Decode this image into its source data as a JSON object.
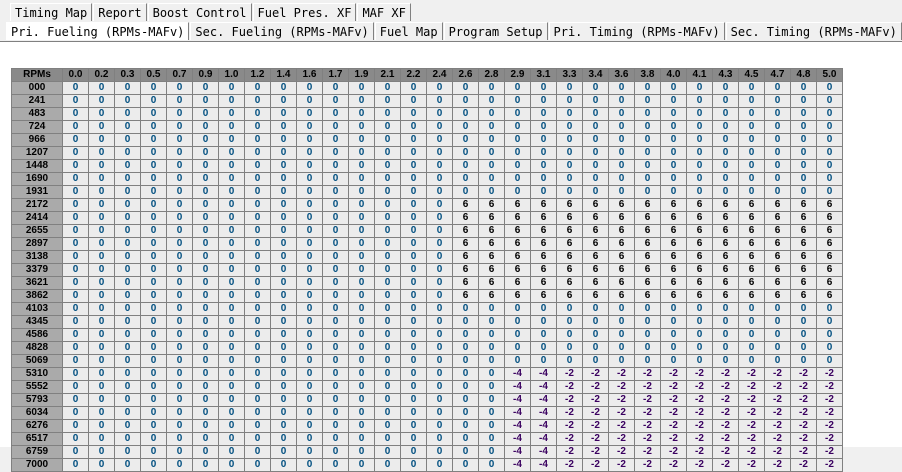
{
  "tabs_row1": [
    "Timing Map",
    "Report",
    "Boost Control",
    "Fuel Pres. XF",
    "MAF XF"
  ],
  "tabs_row2": [
    "Pri. Fueling (RPMs-MAFv)",
    "Sec. Fueling (RPMs-MAFv)",
    "Fuel Map",
    "Program Setup",
    "Pri. Timing (RPMs-MAFv)",
    "Sec. Timing (RPMs-MAFv)"
  ],
  "active_tab": "Pri. Fueling (RPMs-MAFv)",
  "grid": {
    "corner_label": "RPMs",
    "columns": [
      "0.0",
      "0.2",
      "0.3",
      "0.5",
      "0.7",
      "0.9",
      "1.0",
      "1.2",
      "1.4",
      "1.6",
      "1.7",
      "1.9",
      "2.1",
      "2.2",
      "2.4",
      "2.6",
      "2.8",
      "2.9",
      "3.1",
      "3.3",
      "3.4",
      "3.6",
      "3.8",
      "4.0",
      "4.1",
      "4.3",
      "4.5",
      "4.7",
      "4.8",
      "5.0"
    ],
    "rows": [
      {
        "rpm": "000",
        "values": [
          "0",
          "0",
          "0",
          "0",
          "0",
          "0",
          "0",
          "0",
          "0",
          "0",
          "0",
          "0",
          "0",
          "0",
          "0",
          "0",
          "0",
          "0",
          "0",
          "0",
          "0",
          "0",
          "0",
          "0",
          "0",
          "0",
          "0",
          "0",
          "0",
          "0"
        ]
      },
      {
        "rpm": "241",
        "values": [
          "0",
          "0",
          "0",
          "0",
          "0",
          "0",
          "0",
          "0",
          "0",
          "0",
          "0",
          "0",
          "0",
          "0",
          "0",
          "0",
          "0",
          "0",
          "0",
          "0",
          "0",
          "0",
          "0",
          "0",
          "0",
          "0",
          "0",
          "0",
          "0",
          "0"
        ]
      },
      {
        "rpm": "483",
        "values": [
          "0",
          "0",
          "0",
          "0",
          "0",
          "0",
          "0",
          "0",
          "0",
          "0",
          "0",
          "0",
          "0",
          "0",
          "0",
          "0",
          "0",
          "0",
          "0",
          "0",
          "0",
          "0",
          "0",
          "0",
          "0",
          "0",
          "0",
          "0",
          "0",
          "0"
        ]
      },
      {
        "rpm": "724",
        "values": [
          "0",
          "0",
          "0",
          "0",
          "0",
          "0",
          "0",
          "0",
          "0",
          "0",
          "0",
          "0",
          "0",
          "0",
          "0",
          "0",
          "0",
          "0",
          "0",
          "0",
          "0",
          "0",
          "0",
          "0",
          "0",
          "0",
          "0",
          "0",
          "0",
          "0"
        ]
      },
      {
        "rpm": "966",
        "values": [
          "0",
          "0",
          "0",
          "0",
          "0",
          "0",
          "0",
          "0",
          "0",
          "0",
          "0",
          "0",
          "0",
          "0",
          "0",
          "0",
          "0",
          "0",
          "0",
          "0",
          "0",
          "0",
          "0",
          "0",
          "0",
          "0",
          "0",
          "0",
          "0",
          "0"
        ]
      },
      {
        "rpm": "1207",
        "values": [
          "0",
          "0",
          "0",
          "0",
          "0",
          "0",
          "0",
          "0",
          "0",
          "0",
          "0",
          "0",
          "0",
          "0",
          "0",
          "0",
          "0",
          "0",
          "0",
          "0",
          "0",
          "0",
          "0",
          "0",
          "0",
          "0",
          "0",
          "0",
          "0",
          "0"
        ]
      },
      {
        "rpm": "1448",
        "values": [
          "0",
          "0",
          "0",
          "0",
          "0",
          "0",
          "0",
          "0",
          "0",
          "0",
          "0",
          "0",
          "0",
          "0",
          "0",
          "0",
          "0",
          "0",
          "0",
          "0",
          "0",
          "0",
          "0",
          "0",
          "0",
          "0",
          "0",
          "0",
          "0",
          "0"
        ]
      },
      {
        "rpm": "1690",
        "values": [
          "0",
          "0",
          "0",
          "0",
          "0",
          "0",
          "0",
          "0",
          "0",
          "0",
          "0",
          "0",
          "0",
          "0",
          "0",
          "0",
          "0",
          "0",
          "0",
          "0",
          "0",
          "0",
          "0",
          "0",
          "0",
          "0",
          "0",
          "0",
          "0",
          "0"
        ]
      },
      {
        "rpm": "1931",
        "values": [
          "0",
          "0",
          "0",
          "0",
          "0",
          "0",
          "0",
          "0",
          "0",
          "0",
          "0",
          "0",
          "0",
          "0",
          "0",
          "0",
          "0",
          "0",
          "0",
          "0",
          "0",
          "0",
          "0",
          "0",
          "0",
          "0",
          "0",
          "0",
          "0",
          "0"
        ]
      },
      {
        "rpm": "2172",
        "values": [
          "0",
          "0",
          "0",
          "0",
          "0",
          "0",
          "0",
          "0",
          "0",
          "0",
          "0",
          "0",
          "0",
          "0",
          "0",
          "6",
          "6",
          "6",
          "6",
          "6",
          "6",
          "6",
          "6",
          "6",
          "6",
          "6",
          "6",
          "6",
          "6",
          "6"
        ]
      },
      {
        "rpm": "2414",
        "values": [
          "0",
          "0",
          "0",
          "0",
          "0",
          "0",
          "0",
          "0",
          "0",
          "0",
          "0",
          "0",
          "0",
          "0",
          "0",
          "6",
          "6",
          "6",
          "6",
          "6",
          "6",
          "6",
          "6",
          "6",
          "6",
          "6",
          "6",
          "6",
          "6",
          "6"
        ]
      },
      {
        "rpm": "2655",
        "values": [
          "0",
          "0",
          "0",
          "0",
          "0",
          "0",
          "0",
          "0",
          "0",
          "0",
          "0",
          "0",
          "0",
          "0",
          "0",
          "6",
          "6",
          "6",
          "6",
          "6",
          "6",
          "6",
          "6",
          "6",
          "6",
          "6",
          "6",
          "6",
          "6",
          "6"
        ]
      },
      {
        "rpm": "2897",
        "values": [
          "0",
          "0",
          "0",
          "0",
          "0",
          "0",
          "0",
          "0",
          "0",
          "0",
          "0",
          "0",
          "0",
          "0",
          "0",
          "6",
          "6",
          "6",
          "6",
          "6",
          "6",
          "6",
          "6",
          "6",
          "6",
          "6",
          "6",
          "6",
          "6",
          "6"
        ]
      },
      {
        "rpm": "3138",
        "values": [
          "0",
          "0",
          "0",
          "0",
          "0",
          "0",
          "0",
          "0",
          "0",
          "0",
          "0",
          "0",
          "0",
          "0",
          "0",
          "6",
          "6",
          "6",
          "6",
          "6",
          "6",
          "6",
          "6",
          "6",
          "6",
          "6",
          "6",
          "6",
          "6",
          "6"
        ]
      },
      {
        "rpm": "3379",
        "values": [
          "0",
          "0",
          "0",
          "0",
          "0",
          "0",
          "0",
          "0",
          "0",
          "0",
          "0",
          "0",
          "0",
          "0",
          "0",
          "6",
          "6",
          "6",
          "6",
          "6",
          "6",
          "6",
          "6",
          "6",
          "6",
          "6",
          "6",
          "6",
          "6",
          "6"
        ]
      },
      {
        "rpm": "3621",
        "values": [
          "0",
          "0",
          "0",
          "0",
          "0",
          "0",
          "0",
          "0",
          "0",
          "0",
          "0",
          "0",
          "0",
          "0",
          "0",
          "6",
          "6",
          "6",
          "6",
          "6",
          "6",
          "6",
          "6",
          "6",
          "6",
          "6",
          "6",
          "6",
          "6",
          "6"
        ]
      },
      {
        "rpm": "3862",
        "values": [
          "0",
          "0",
          "0",
          "0",
          "0",
          "0",
          "0",
          "0",
          "0",
          "0",
          "0",
          "0",
          "0",
          "0",
          "0",
          "6",
          "6",
          "6",
          "6",
          "6",
          "6",
          "6",
          "6",
          "6",
          "6",
          "6",
          "6",
          "6",
          "6",
          "6"
        ]
      },
      {
        "rpm": "4103",
        "values": [
          "0",
          "0",
          "0",
          "0",
          "0",
          "0",
          "0",
          "0",
          "0",
          "0",
          "0",
          "0",
          "0",
          "0",
          "0",
          "0",
          "0",
          "0",
          "0",
          "0",
          "0",
          "0",
          "0",
          "0",
          "0",
          "0",
          "0",
          "0",
          "0",
          "0"
        ]
      },
      {
        "rpm": "4345",
        "values": [
          "0",
          "0",
          "0",
          "0",
          "0",
          "0",
          "0",
          "0",
          "0",
          "0",
          "0",
          "0",
          "0",
          "0",
          "0",
          "0",
          "0",
          "0",
          "0",
          "0",
          "0",
          "0",
          "0",
          "0",
          "0",
          "0",
          "0",
          "0",
          "0",
          "0"
        ]
      },
      {
        "rpm": "4586",
        "values": [
          "0",
          "0",
          "0",
          "0",
          "0",
          "0",
          "0",
          "0",
          "0",
          "0",
          "0",
          "0",
          "0",
          "0",
          "0",
          "0",
          "0",
          "0",
          "0",
          "0",
          "0",
          "0",
          "0",
          "0",
          "0",
          "0",
          "0",
          "0",
          "0",
          "0"
        ]
      },
      {
        "rpm": "4828",
        "values": [
          "0",
          "0",
          "0",
          "0",
          "0",
          "0",
          "0",
          "0",
          "0",
          "0",
          "0",
          "0",
          "0",
          "0",
          "0",
          "0",
          "0",
          "0",
          "0",
          "0",
          "0",
          "0",
          "0",
          "0",
          "0",
          "0",
          "0",
          "0",
          "0",
          "0"
        ]
      },
      {
        "rpm": "5069",
        "values": [
          "0",
          "0",
          "0",
          "0",
          "0",
          "0",
          "0",
          "0",
          "0",
          "0",
          "0",
          "0",
          "0",
          "0",
          "0",
          "0",
          "0",
          "0",
          "0",
          "0",
          "0",
          "0",
          "0",
          "0",
          "0",
          "0",
          "0",
          "0",
          "0",
          "0"
        ]
      },
      {
        "rpm": "5310",
        "values": [
          "0",
          "0",
          "0",
          "0",
          "0",
          "0",
          "0",
          "0",
          "0",
          "0",
          "0",
          "0",
          "0",
          "0",
          "0",
          "0",
          "0",
          "-4",
          "-4",
          "-2",
          "-2",
          "-2",
          "-2",
          "-2",
          "-2",
          "-2",
          "-2",
          "-2",
          "-2",
          "-2"
        ]
      },
      {
        "rpm": "5552",
        "values": [
          "0",
          "0",
          "0",
          "0",
          "0",
          "0",
          "0",
          "0",
          "0",
          "0",
          "0",
          "0",
          "0",
          "0",
          "0",
          "0",
          "0",
          "-4",
          "-4",
          "-2",
          "-2",
          "-2",
          "-2",
          "-2",
          "-2",
          "-2",
          "-2",
          "-2",
          "-2",
          "-2"
        ]
      },
      {
        "rpm": "5793",
        "values": [
          "0",
          "0",
          "0",
          "0",
          "0",
          "0",
          "0",
          "0",
          "0",
          "0",
          "0",
          "0",
          "0",
          "0",
          "0",
          "0",
          "0",
          "-4",
          "-4",
          "-2",
          "-2",
          "-2",
          "-2",
          "-2",
          "-2",
          "-2",
          "-2",
          "-2",
          "-2",
          "-2"
        ]
      },
      {
        "rpm": "6034",
        "values": [
          "0",
          "0",
          "0",
          "0",
          "0",
          "0",
          "0",
          "0",
          "0",
          "0",
          "0",
          "0",
          "0",
          "0",
          "0",
          "0",
          "0",
          "-4",
          "-4",
          "-2",
          "-2",
          "-2",
          "-2",
          "-2",
          "-2",
          "-2",
          "-2",
          "-2",
          "-2",
          "-2"
        ]
      },
      {
        "rpm": "6276",
        "values": [
          "0",
          "0",
          "0",
          "0",
          "0",
          "0",
          "0",
          "0",
          "0",
          "0",
          "0",
          "0",
          "0",
          "0",
          "0",
          "0",
          "0",
          "-4",
          "-4",
          "-2",
          "-2",
          "-2",
          "-2",
          "-2",
          "-2",
          "-2",
          "-2",
          "-2",
          "-2",
          "-2"
        ]
      },
      {
        "rpm": "6517",
        "values": [
          "0",
          "0",
          "0",
          "0",
          "0",
          "0",
          "0",
          "0",
          "0",
          "0",
          "0",
          "0",
          "0",
          "0",
          "0",
          "0",
          "0",
          "-4",
          "-4",
          "-2",
          "-2",
          "-2",
          "-2",
          "-2",
          "-2",
          "-2",
          "-2",
          "-2",
          "-2",
          "-2"
        ]
      },
      {
        "rpm": "6759",
        "values": [
          "0",
          "0",
          "0",
          "0",
          "0",
          "0",
          "0",
          "0",
          "0",
          "0",
          "0",
          "0",
          "0",
          "0",
          "0",
          "0",
          "0",
          "-4",
          "-4",
          "-2",
          "-2",
          "-2",
          "-2",
          "-2",
          "-2",
          "-2",
          "-2",
          "-2",
          "-2",
          "-2"
        ]
      },
      {
        "rpm": "7000",
        "values": [
          "0",
          "0",
          "0",
          "0",
          "0",
          "0",
          "0",
          "0",
          "0",
          "0",
          "0",
          "0",
          "0",
          "0",
          "0",
          "0",
          "0",
          "-4",
          "-4",
          "-2",
          "-2",
          "-2",
          "-2",
          "-2",
          "-2",
          "-2",
          "-2",
          "-2",
          "-2",
          "-2"
        ]
      }
    ]
  },
  "colors": {
    "zero": "#004f80",
    "positive": "#000000",
    "negative": "#3a0060",
    "header_bg": "#8a8a8a",
    "rpm_bg": "#aaaaaa",
    "cell_bg": "#ececec"
  }
}
